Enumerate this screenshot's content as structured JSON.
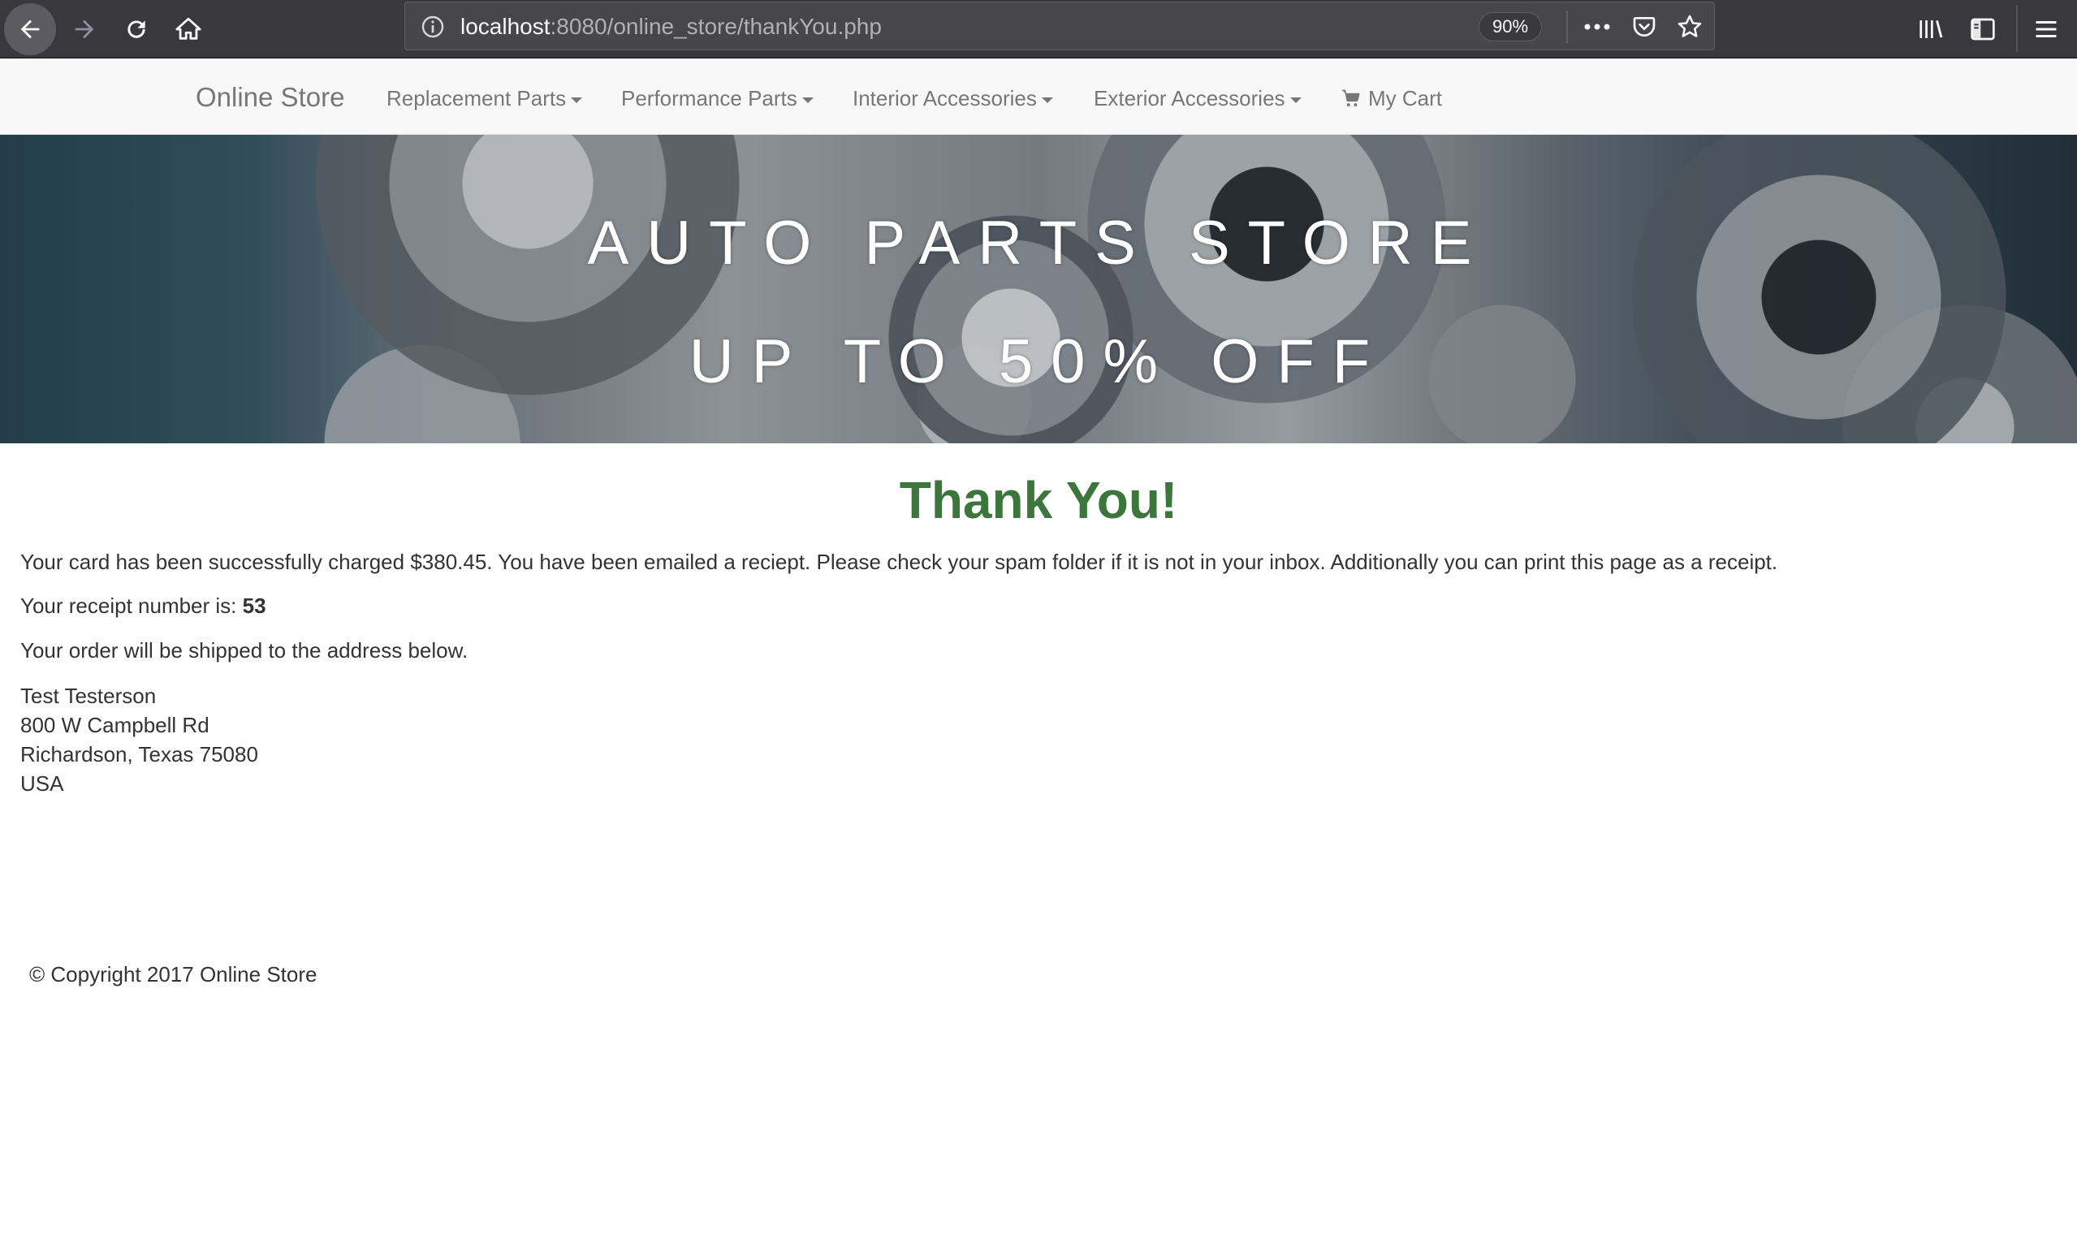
{
  "browser": {
    "url_host": "localhost",
    "url_rest": ":8080/online_store/thankYou.php",
    "zoom": "90%"
  },
  "icons": {
    "back": "back-arrow-icon",
    "forward": "forward-arrow-icon",
    "reload": "reload-icon",
    "home": "home-icon",
    "info": "info-icon",
    "more": "more-icon",
    "pocket": "pocket-icon",
    "bookmark": "star-icon",
    "library": "library-icon",
    "sidebar": "sidebar-icon",
    "menu": "hamburger-menu-icon",
    "cart": "cart-icon"
  },
  "nav": {
    "brand": "Online Store",
    "items": [
      {
        "label": "Replacement Parts"
      },
      {
        "label": "Performance Parts"
      },
      {
        "label": "Interior Accessories"
      },
      {
        "label": "Exterior Accessories"
      }
    ],
    "cart_label": "My Cart"
  },
  "hero": {
    "title": "AUTO PARTS STORE",
    "subtitle": "UP TO 50% OFF"
  },
  "main": {
    "heading": "Thank You!",
    "charged_text": "Your card has been successfully charged $380.45. You have been emailed a reciept. Please check your spam folder if it is not in your inbox. Additionally you can print this page as a receipt.",
    "receipt_label": "Your receipt number is: ",
    "receipt_number": "53",
    "ship_text": "Your order will be shipped to the address below.",
    "address": {
      "name": "Test Testerson",
      "street": "800 W Campbell Rd",
      "city_state_zip": "Richardson, Texas 75080",
      "country": "USA"
    }
  },
  "footer": {
    "copyright": "© Copyright 2017 Online Store"
  },
  "colors": {
    "heading_green": "#3c763d",
    "chrome_bg": "#38383d",
    "navbar_bg": "#f8f8f8"
  }
}
